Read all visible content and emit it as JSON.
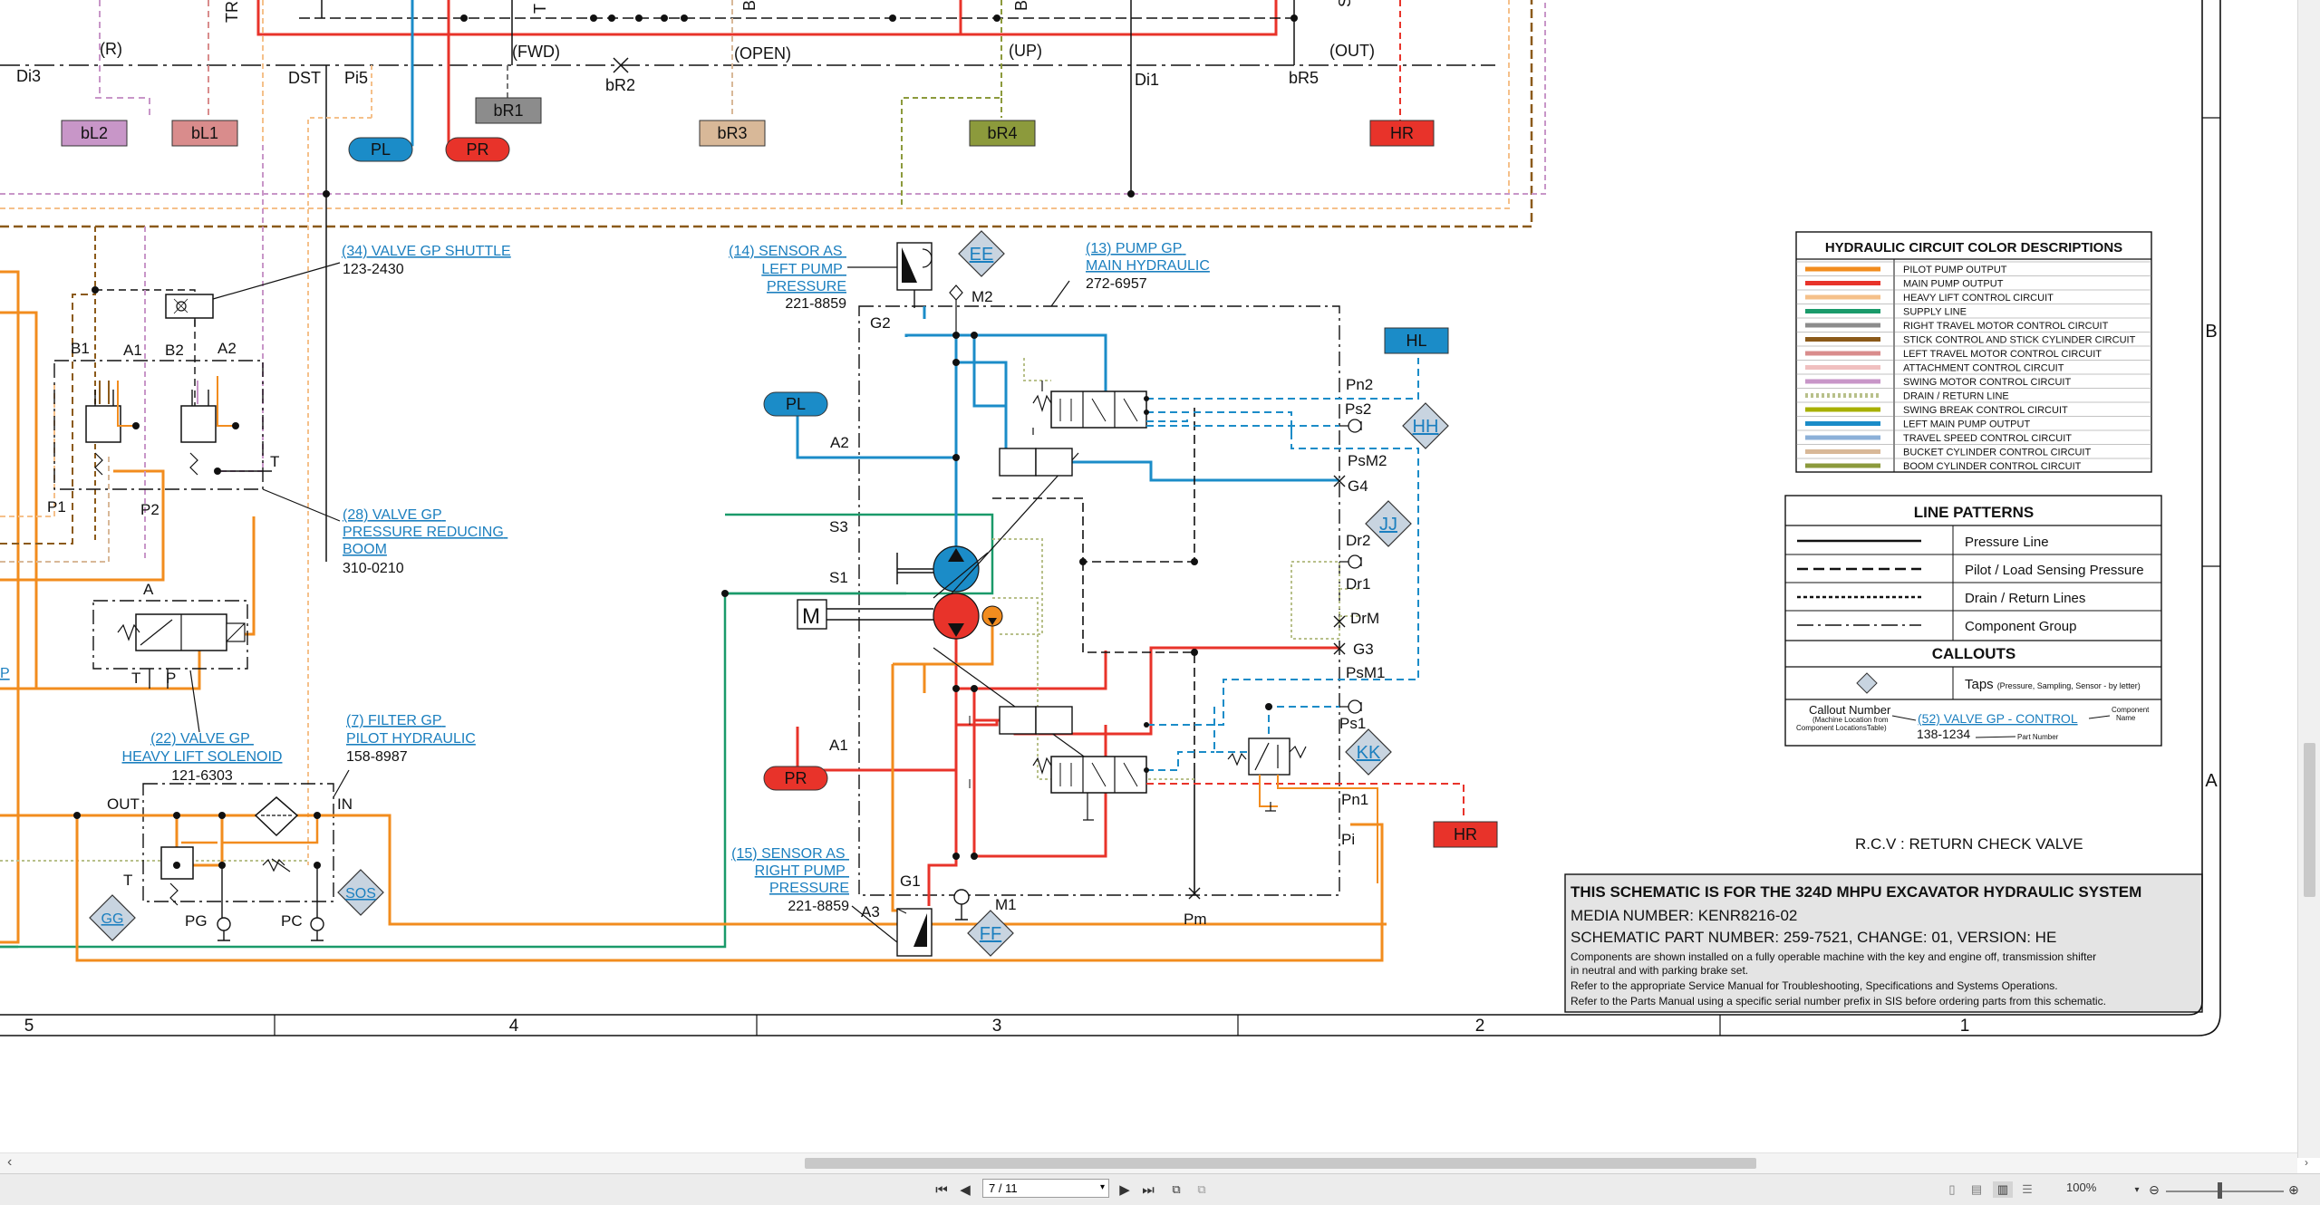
{
  "viewer": {
    "page_field": "7 / 11",
    "zoom_label": "100%",
    "first_page_icon": "first-page-icon",
    "prev_page_icon": "prev-page-icon",
    "next_page_icon": "next-page-icon",
    "last_page_icon": "last-page-icon"
  },
  "colors": {
    "pilot": "#f28c1e",
    "main_pump": "#e8332a",
    "heavy_lift": "#f5c08a",
    "supply": "#1a9a6a",
    "right_travel": "#8c8c8c",
    "stick_boom_ctrl": "#8b5a1a",
    "left_travel": "#d98c8c",
    "attachment": "#f0c0c0",
    "swing": "#c896c8",
    "drain": "#b8c08a",
    "swing_brake": "#a8b000",
    "left_main_pump": "#1b8cc8",
    "travel_speed": "#8cb0d8",
    "bucket": "#d8b898",
    "boom_cyl": "#8c9a3c",
    "callout_diamond": "#c8d4e0",
    "link": "#1b7fbf"
  },
  "schematic": {
    "top_labels": {
      "r": "(R)",
      "fwd": "(FWD)",
      "open": "(OPEN)",
      "up": "(UP)",
      "out": "(OUT)",
      "di3": "Di3",
      "dst": "DST",
      "pi5": "Pi5",
      "br2": "bR2",
      "di1": "Di1",
      "br5": "bR5",
      "t1": "TR",
      "t2": "T",
      "b1": "B",
      "b2": "B",
      "s1": "S"
    },
    "boxes": {
      "bl2": "bL2",
      "bl1": "bL1",
      "br1": "bR1",
      "br3": "bR3",
      "br4": "bR4",
      "hr_top": "HR",
      "pl_top": "PL",
      "pr_top": "PR",
      "hl": "HL",
      "pl_mid": "PL",
      "pr_mid": "PR",
      "hr_bottom": "HR"
    },
    "callouts": {
      "shuttle_link": "(34) VALVE GP SHUTTLE",
      "shuttle_num": "123-2430",
      "reducing_link": [
        "(28) VALVE GP",
        "PRESSURE REDUCING",
        "BOOM"
      ],
      "reducing_num": "310-0210",
      "solenoid_link": [
        "(22) VALVE GP",
        "HEAVY LIFT SOLENOID"
      ],
      "solenoid_num": "121-6303",
      "filter_link": [
        "(7) FILTER GP",
        "PILOT HYDRAULIC"
      ],
      "filter_num": "158-8987",
      "sensor_left_link": [
        "(14) SENSOR AS",
        "LEFT PUMP",
        "PRESSURE"
      ],
      "sensor_left_num": "221-8859",
      "sensor_right_link": [
        "(15) SENSOR AS",
        "RIGHT PUMP",
        "PRESSURE"
      ],
      "sensor_right_num": "221-8859",
      "pump_link": [
        "(13) PUMP GP",
        "MAIN HYDRAULIC"
      ],
      "pump_num": "272-6957",
      "p_edge": "P"
    },
    "taps": [
      "EE",
      "HH",
      "JJ",
      "KK",
      "FF",
      "SOS",
      "GG"
    ],
    "port_labels": {
      "b1": "B1",
      "a1": "A1",
      "b2": "B2",
      "a2": "A2",
      "t": "T",
      "p1": "P1",
      "p2": "P2",
      "sol_a": "A",
      "sol_t": "T",
      "sol_p": "P",
      "out": "OUT",
      "in": "IN",
      "f_t": "T",
      "pg": "PG",
      "pc": "PC",
      "m2": "M2",
      "g2": "G2",
      "pump_a2": "A2",
      "s3": "S3",
      "s1": "S1",
      "pump_a1": "A1",
      "g1": "G1",
      "a3": "A3",
      "m1": "M1",
      "pm": "Pm",
      "pn2": "Pn2",
      "ps2": "Ps2",
      "psm2": "PsM2",
      "g4": "G4",
      "dr2": "Dr2",
      "dr1": "Dr1",
      "drm": "DrM",
      "g3": "G3",
      "psm1": "PsM1",
      "ps1": "Ps1",
      "pn1": "Pn1",
      "pi": "Pi"
    },
    "rcv_note": "R.C.V : RETURN CHECK VALVE",
    "grid_numbers": [
      "5",
      "4",
      "3",
      "2",
      "1"
    ],
    "grid_letters": [
      "B",
      "A"
    ]
  },
  "legend": {
    "title": "HYDRAULIC CIRCUIT COLOR DESCRIPTIONS",
    "items": [
      {
        "label": "PILOT PUMP OUTPUT",
        "color": "#f28c1e",
        "dotted": false
      },
      {
        "label": "MAIN PUMP OUTPUT",
        "color": "#e8332a",
        "dotted": false
      },
      {
        "label": "HEAVY LIFT CONTROL CIRCUIT",
        "color": "#f5c08a",
        "dotted": false
      },
      {
        "label": "SUPPLY LINE",
        "color": "#1a9a6a",
        "dotted": false
      },
      {
        "label": "RIGHT TRAVEL MOTOR CONTROL CIRCUIT",
        "color": "#8c8c8c",
        "dotted": false
      },
      {
        "label": "STICK CONTROL AND STICK CYLINDER CIRCUIT",
        "color": "#8b5a1a",
        "dotted": false
      },
      {
        "label": "LEFT TRAVEL MOTOR CONTROL CIRCUIT",
        "color": "#d98c8c",
        "dotted": false
      },
      {
        "label": "ATTACHMENT CONTROL CIRCUIT",
        "color": "#f0c0c0",
        "dotted": false
      },
      {
        "label": "SWING MOTOR CONTROL CIRCUIT",
        "color": "#c896c8",
        "dotted": false
      },
      {
        "label": "DRAIN / RETURN LINE",
        "color": "#b8c08a",
        "dotted": true
      },
      {
        "label": "SWING BREAK CONTROL CIRCUIT",
        "color": "#a8b000",
        "dotted": false
      },
      {
        "label": "LEFT MAIN PUMP OUTPUT",
        "color": "#1b8cc8",
        "dotted": false
      },
      {
        "label": "TRAVEL SPEED CONTROL CIRCUIT",
        "color": "#8cb0d8",
        "dotted": false
      },
      {
        "label": "BUCKET CYLINDER CONTROL CIRCUIT",
        "color": "#d8b898",
        "dotted": false
      },
      {
        "label": "BOOM CYLINDER CONTROL CIRCUIT",
        "color": "#8c9a3c",
        "dotted": false
      }
    ]
  },
  "line_patterns": {
    "title": "LINE PATTERNS",
    "items": [
      "Pressure Line",
      "Pilot / Load Sensing Pressure",
      "Drain / Return Lines",
      "Component Group"
    ],
    "callouts_title": "CALLOUTS",
    "taps_label": "Taps",
    "taps_note": "(Pressure, Sampling, Sensor - by letter)",
    "callout_number": "Callout Number",
    "machine_location": [
      "(Machine Location from",
      "Component LocationsTable)"
    ],
    "example_link": "(52) VALVE GP - CONTROL",
    "example_part": "138-1234",
    "component_name": [
      "Component",
      "Name"
    ],
    "part_number": "Part Number"
  },
  "title_block": {
    "heading": "THIS SCHEMATIC IS FOR THE 324D MHPU EXCAVATOR HYDRAULIC SYSTEM",
    "media": "MEDIA NUMBER: KENR8216-02",
    "schematic_part": "SCHEMATIC PART NUMBER: 259-7521, CHANGE: 01, VERSION: HE",
    "notes": [
      "Components are shown installed on a fully operable machine with the key and engine off, transmission shifter",
      "in neutral and with parking brake set.",
      "Refer to the appropriate Service Manual for Troubleshooting, Specifications and Systems Operations.",
      "Refer to the Parts Manual using a specific serial number prefix in SIS before ordering parts from this schematic."
    ]
  }
}
